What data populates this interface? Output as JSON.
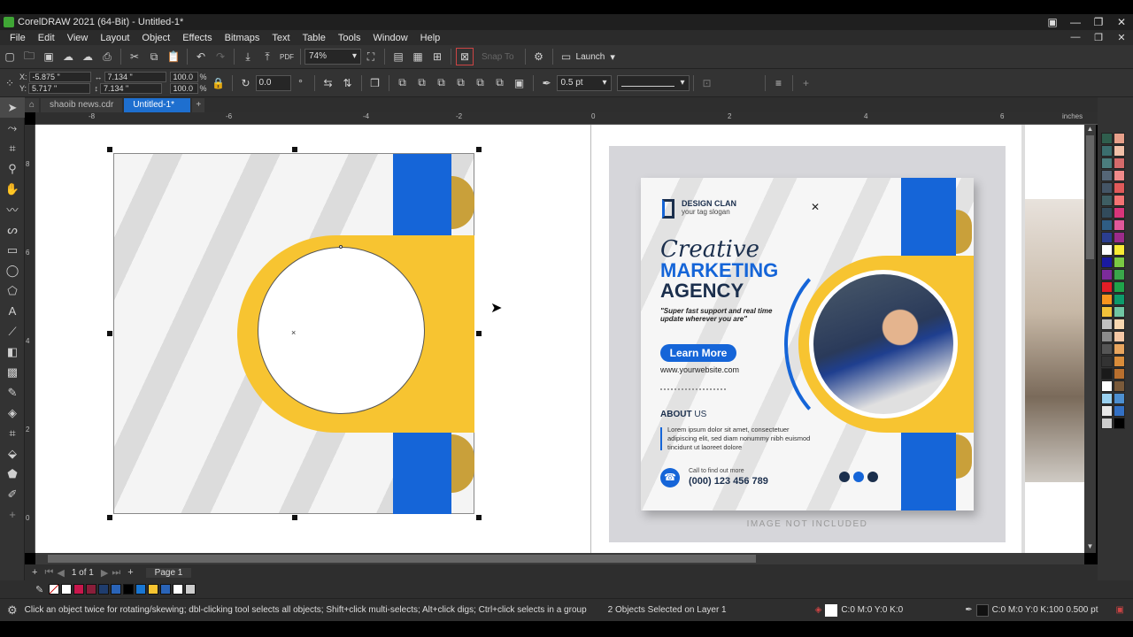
{
  "app": {
    "title": "CorelDRAW 2021 (64-Bit) - Untitled-1*",
    "window_controls": [
      "▣",
      "—",
      "❐",
      "✕"
    ]
  },
  "menu": [
    "File",
    "Edit",
    "View",
    "Layout",
    "Object",
    "Effects",
    "Bitmaps",
    "Text",
    "Table",
    "Tools",
    "Window",
    "Help"
  ],
  "toolbar": {
    "zoom": "74%",
    "launch_label": "Launch",
    "snap_to_label": "Snap To"
  },
  "properties": {
    "x_label": "X:",
    "x_value": "-5.875 \"",
    "y_label": "Y:",
    "y_value": "5.717 \"",
    "w_value": "7.134 \"",
    "h_value": "7.134 \"",
    "scale_w": "100.0",
    "scale_h": "100.0",
    "pct": "%",
    "rotation": "0.0",
    "outline_width": "0.5 pt"
  },
  "tabs": [
    {
      "label": "shaoib news.cdr",
      "active": false
    },
    {
      "label": "Untitled-1*",
      "active": true
    }
  ],
  "ruler": {
    "units": "inches",
    "h_ticks": [
      "-8",
      "-6",
      "-4",
      "-2",
      "0",
      "2",
      "4",
      "6"
    ],
    "v_ticks": [
      "8",
      "6",
      "4",
      "2",
      "0"
    ]
  },
  "page_nav": {
    "page_count": "1 of 1",
    "page_tab": "Page 1"
  },
  "status": {
    "hint": "Click an object twice for rotating/skewing; dbl-clicking tool selects all objects; Shift+click multi-selects; Alt+click digs; Ctrl+click selects in a group",
    "selection": "2 Objects Selected on Layer 1",
    "fill": "C:0 M:0 Y:0 K:0",
    "outline": "C:0 M:0 Y:0 K:100  0.500 pt"
  },
  "design": {
    "brand_name": "DESIGN CLAN",
    "brand_slogan": "your tag slogan",
    "headline_script": "Creative",
    "headline_1": "MARKETING",
    "headline_2": "AGENCY",
    "tagline": "\"Super fast support and real time update wherever you are\"",
    "cta": "Learn More",
    "website": "www.yourwebsite.com",
    "about_label": "ABOUT",
    "about_us": "US",
    "about_text": "Lorem ipsum dolor sit amet, consectetuer adipiscing elit, sed diam nonummy nibh euismod tincidunt ut laoreet dolore",
    "call_label": "Call to find out more",
    "phone": "(000) 123 456 789",
    "footer_note": "IMAGE NOT INCLUDED"
  },
  "colors": {
    "blue": "#1565d8",
    "yellow": "#f7c431",
    "gold": "#c9a03a",
    "navy": "#1b2f4d"
  },
  "doc_palette": [
    "#ffffff",
    "#c8174c",
    "#8a1e3a",
    "#1f3d6e",
    "#2a64b8",
    "#000000",
    "#1976d2",
    "#f7c431",
    "#2a64b8",
    "#ffffff",
    "#cccccc"
  ],
  "color_palette": [
    "#2f5e4d",
    "#e7a08a",
    "#3b6e6e",
    "#f1c0a8",
    "#4b7d7d",
    "#d56b6b",
    "#567",
    "#f08a8a",
    "#456",
    "#e05a5a",
    "#3e5e63",
    "#f47373",
    "#324b5c",
    "#d8357a",
    "#2f5d84",
    "#e0589a",
    "#2b3e8f",
    "#9b2b8a",
    "#ffffff",
    "#f8ea35",
    "#1a1aa0",
    "#7ac943",
    "#7c2b9b",
    "#3aa64a",
    "#e41e26",
    "#1fa34a",
    "#f7941e",
    "#0d9b6b",
    "#f2c23a",
    "#70c6a3",
    "#bfbfbf",
    "#f7d7b0",
    "#8c8c8c",
    "#f5c7a5",
    "#555",
    "#e8a55e",
    "#333",
    "#d98c3a",
    "#1a1a1a",
    "#b86f2e",
    "#ffffff",
    "#7a5a3a",
    "#9ad1f0",
    "#4d8fd0",
    "#e8e8e8",
    "#3370c4",
    "#ccc",
    "#000"
  ]
}
